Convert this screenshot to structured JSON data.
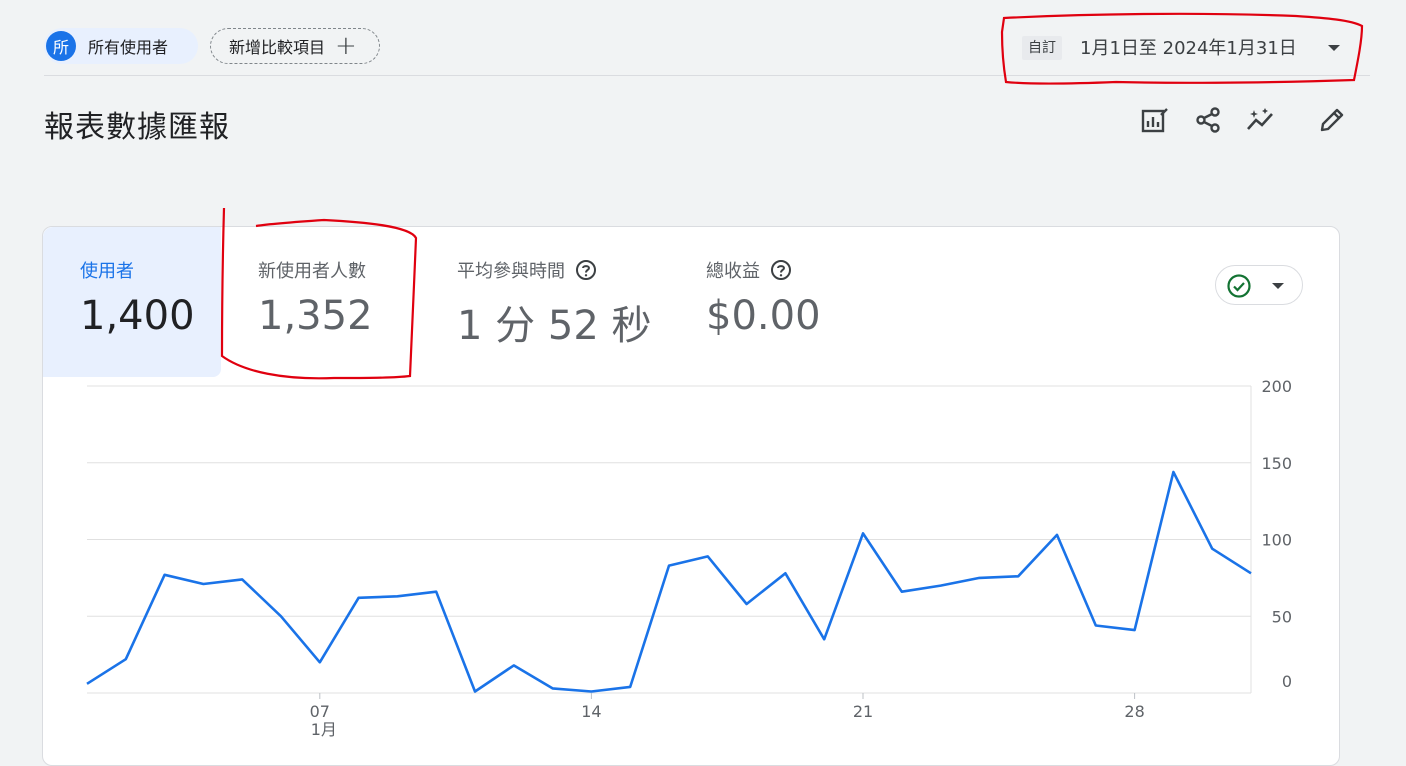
{
  "topbar": {
    "audience_avatar": "所",
    "audience_label": "所有使用者",
    "compare_label": "新增比較項目",
    "compare_plus": "+",
    "date_badge": "自訂",
    "date_range": "1月1日至 2024年1月31日"
  },
  "page": {
    "title": "報表數據匯報"
  },
  "toolbar": {
    "icons": [
      "edit-chart-icon",
      "share-icon",
      "insights-icon",
      "pencil-icon"
    ]
  },
  "metrics": [
    {
      "label": "使用者",
      "value": "1,400",
      "help": false
    },
    {
      "label": "新使用者人數",
      "value": "1,352",
      "help": false
    },
    {
      "label": "平均參與時間",
      "value": "1 分 52 秒",
      "help": true
    },
    {
      "label": "總收益",
      "value": "$0.00",
      "help": true
    }
  ],
  "colors": {
    "accent": "#1a73e8",
    "line": "#1a73e8",
    "annotation": "#e0000f",
    "check": "#137333"
  },
  "chart_data": {
    "type": "line",
    "series": [
      {
        "x": [
          "2024-01-01",
          "2024-01-02",
          "2024-01-03",
          "2024-01-04",
          "2024-01-05",
          "2024-01-06",
          "2024-01-07",
          "2024-01-08",
          "2024-01-09",
          "2024-01-10",
          "2024-01-11",
          "2024-01-12",
          "2024-01-13",
          "2024-01-14",
          "2024-01-15",
          "2024-01-16",
          "2024-01-17",
          "2024-01-18",
          "2024-01-19",
          "2024-01-20",
          "2024-01-21",
          "2024-01-22",
          "2024-01-23",
          "2024-01-24",
          "2024-01-25",
          "2024-01-26",
          "2024-01-27",
          "2024-01-28",
          "2024-01-29",
          "2024-01-30",
          "2024-01-31"
        ],
        "values": [
          6,
          22,
          77,
          71,
          74,
          50,
          20,
          62,
          63,
          66,
          1,
          18,
          3,
          1,
          4,
          83,
          89,
          58,
          78,
          35,
          104,
          66,
          70,
          75,
          76,
          103,
          44,
          41,
          144,
          94,
          78
        ]
      }
    ],
    "x_tick_labels": [
      "07",
      "14",
      "21",
      "28"
    ],
    "x_tick_sublabel": "1月",
    "y_tick_labels": [
      "0",
      "50",
      "100",
      "150",
      "200"
    ],
    "ylim": [
      0,
      200
    ],
    "y_axis_position": "right",
    "grid": true
  }
}
